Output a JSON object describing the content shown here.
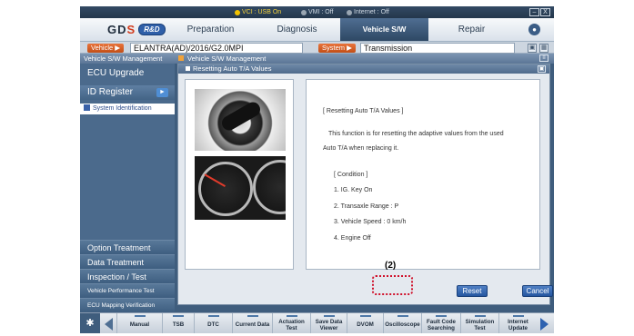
{
  "status": {
    "vci": "VCI : USB On",
    "vmi": "VMI : Off",
    "internet": "Internet : Off",
    "colors": {
      "vci": "#f2c200",
      "vmi": "#9aa6b2",
      "internet": "#9aa6b2"
    }
  },
  "window": {
    "minimize": "–",
    "close": "X"
  },
  "logo": {
    "brand_left": "G",
    "brand_mid": "D",
    "brand_right": "S",
    "badge": "R&D"
  },
  "menu": [
    "Preparation",
    "Diagnosis",
    "Vehicle S/W Management",
    "Repair"
  ],
  "vehicle": {
    "label": "Vehicle",
    "value": "ELANTRA(AD)/2016/G2.0MPI"
  },
  "system": {
    "label": "System",
    "value": "Transmission"
  },
  "section": {
    "left": "Vehicle S/W Management",
    "right": "Vehicle S/W Management"
  },
  "sidebar": {
    "ecu_upgrade": "ECU Upgrade",
    "id_register": "ID Register",
    "system_identification": "System Identification",
    "bottom": [
      "Option Treatment",
      "Data Treatment",
      "Inspection / Test",
      "Vehicle Performance Test",
      "ECU Mapping Verification"
    ]
  },
  "panel": {
    "title": "Resetting Auto T/A Values",
    "lines": [
      "[ Resetting Auto T/A Values ]",
      "This function is for resetting the adaptive values from the used",
      "Auto T/A when replacing it.",
      "[ Condition ]",
      "1. IG. Key On",
      "2. Transaxle Range : P",
      "3. Vehicle Speed : 0 km/h",
      "4. Engine Off"
    ],
    "reset": "Reset",
    "cancel": "Cancel"
  },
  "annotation": "(2)",
  "toolbar": [
    {
      "l1": "Manual",
      "l2": ""
    },
    {
      "l1": "TSB",
      "l2": ""
    },
    {
      "l1": "DTC",
      "l2": ""
    },
    {
      "l1": "Current Data",
      "l2": ""
    },
    {
      "l1": "Actuation",
      "l2": "Test"
    },
    {
      "l1": "Save Data",
      "l2": "Viewer"
    },
    {
      "l1": "DVOM",
      "l2": ""
    },
    {
      "l1": "Oscilloscope",
      "l2": ""
    },
    {
      "l1": "Fault Code",
      "l2": "Searching"
    },
    {
      "l1": "Simulation",
      "l2": "Test"
    },
    {
      "l1": "Internet",
      "l2": "Update"
    }
  ]
}
